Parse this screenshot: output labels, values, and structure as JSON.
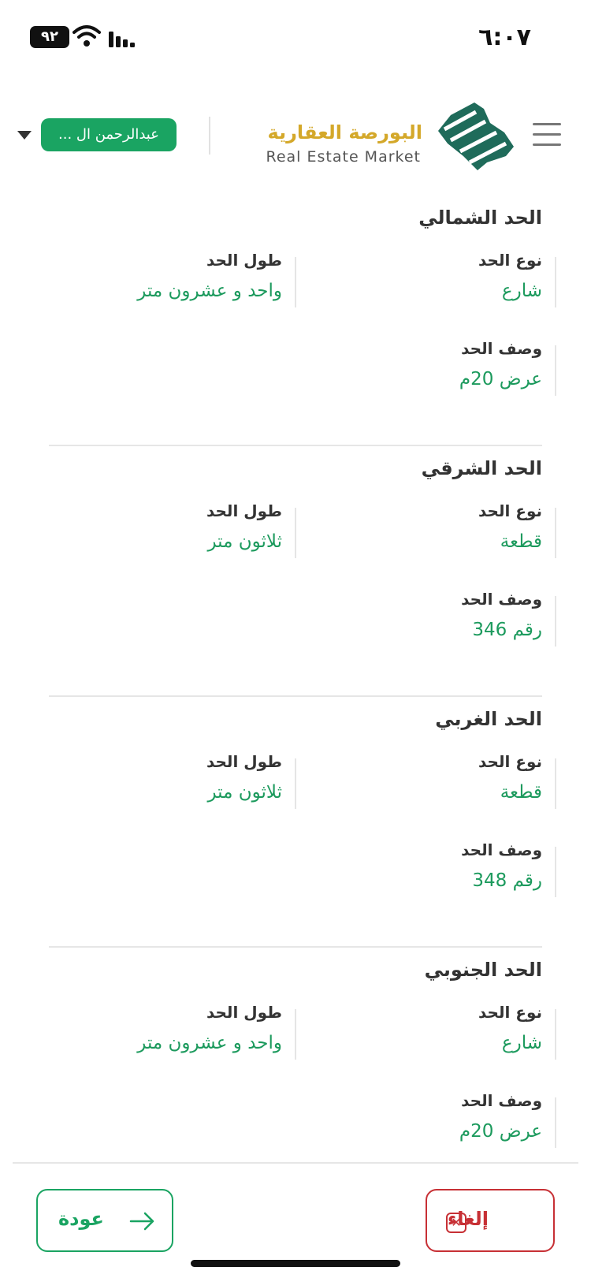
{
  "status_bar": {
    "time": "٦:٠٧",
    "battery": "٩٢",
    "icons": [
      "wifi-icon",
      "signal-icon"
    ]
  },
  "header": {
    "logo_ar": "البورصة العقارية",
    "logo_en": "Real Estate Market",
    "user_name": "عبدالرحمن ال ...",
    "icons": [
      "menu-icon",
      "logo-emblem",
      "chevron-down-icon"
    ]
  },
  "sections": [
    {
      "title": "الحد الشمالي",
      "type_label": "نوع الحد",
      "type_value": "شارع",
      "length_label": "طول الحد",
      "length_value": "واحد و عشرون متر",
      "desc_label": "وصف الحد",
      "desc_value": "عرض 20م"
    },
    {
      "title": "الحد الشرقي",
      "type_label": "نوع الحد",
      "type_value": "قطعة",
      "length_label": "طول الحد",
      "length_value": "ثلاثون متر",
      "desc_label": "وصف الحد",
      "desc_value": "رقم 346"
    },
    {
      "title": "الحد الغربي",
      "type_label": "نوع الحد",
      "type_value": "قطعة",
      "length_label": "طول الحد",
      "length_value": "ثلاثون متر",
      "desc_label": "وصف الحد",
      "desc_value": "رقم 348"
    },
    {
      "title": "الحد الجنوبي",
      "type_label": "نوع الحد",
      "type_value": "شارع",
      "length_label": "طول الحد",
      "length_value": "واحد و عشرون متر",
      "desc_label": "وصف الحد",
      "desc_value": "عرض 20م"
    }
  ],
  "footer": {
    "back_label": "عودة",
    "cancel_label": "إلغاء",
    "icons": [
      "arrow-right-icon",
      "close-box-icon"
    ]
  },
  "colors": {
    "brand_green": "#1aa462",
    "value_green": "#1c9a5d",
    "logo_gold": "#d4a82a",
    "cancel_red": "#c73035"
  }
}
